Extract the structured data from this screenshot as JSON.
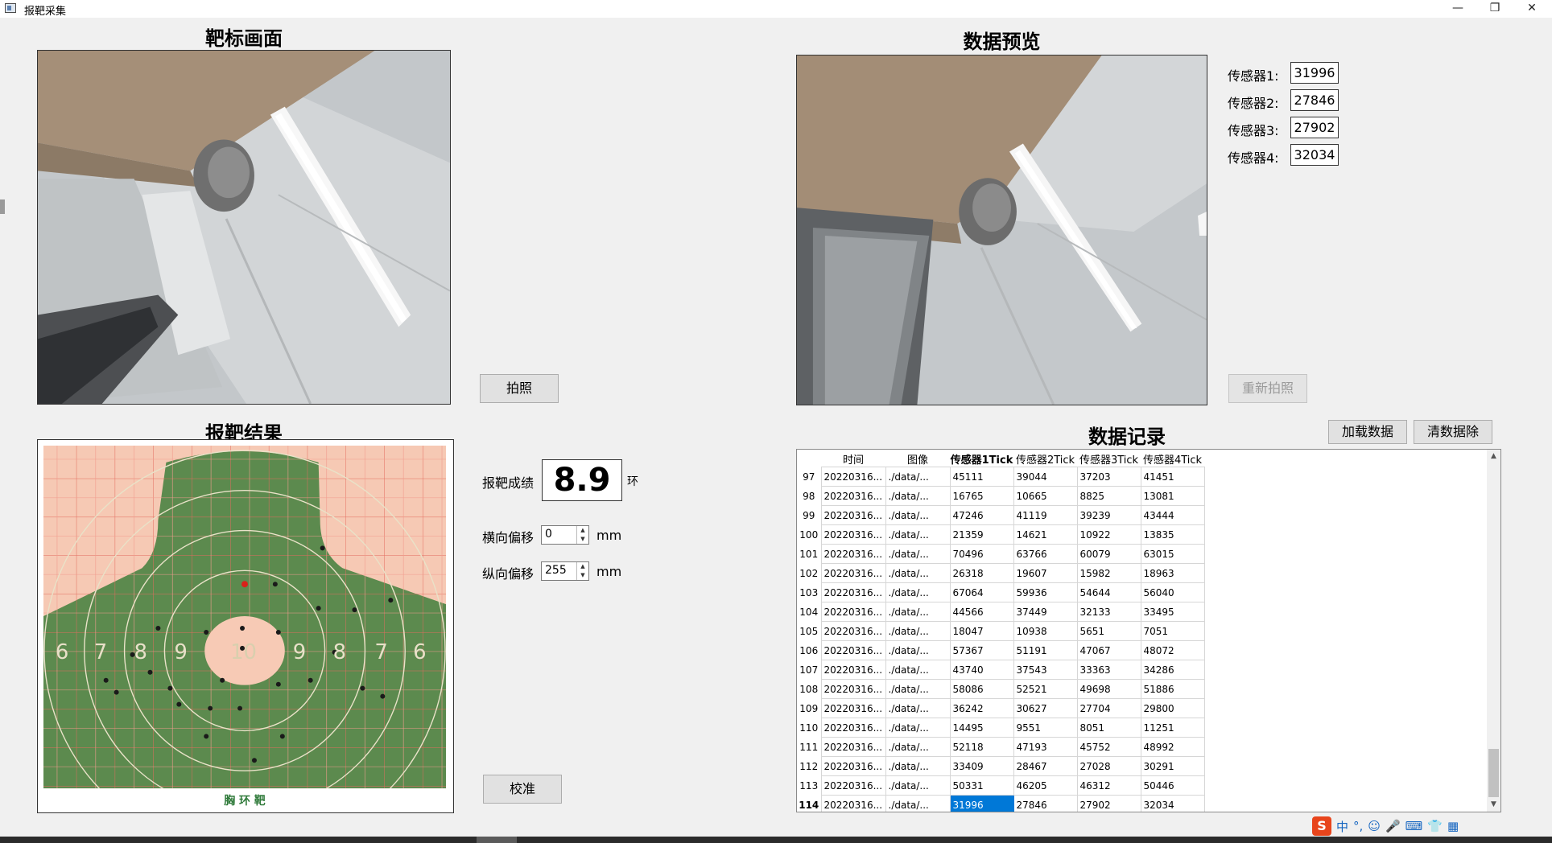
{
  "window": {
    "title": "报靶采集",
    "minimize": "—",
    "restore": "❐",
    "close": "✕"
  },
  "left": {
    "camera_heading": "靶标画面",
    "capture_button": "拍照",
    "result_heading": "报靶结果",
    "target_caption": "胸    环    靶",
    "ring_labels_left": [
      "6",
      "7",
      "8",
      "9",
      "10"
    ],
    "ring_labels_right": [
      "9",
      "8",
      "7",
      "6"
    ],
    "score_label": "报靶成绩",
    "score_value": "8.9",
    "score_unit": "环",
    "h_offset_label": "横向偏移",
    "h_offset_value": "0",
    "v_offset_label": "纵向偏移",
    "v_offset_value": "255",
    "offset_unit": "mm",
    "calibrate_button": "校准"
  },
  "right": {
    "preview_heading": "数据预览",
    "retake_button": "重新拍照",
    "sensors": [
      {
        "label": "传感器1:",
        "value": "31996"
      },
      {
        "label": "传感器2:",
        "value": "27846"
      },
      {
        "label": "传感器3:",
        "value": "27902"
      },
      {
        "label": "传感器4:",
        "value": "32034"
      }
    ],
    "records_heading": "数据记录",
    "load_button": "加载数据",
    "clear_button": "清数据除",
    "table": {
      "headers": [
        "时间",
        "图像",
        "传感器1Tick",
        "传感器2Tick",
        "传感器3Tick",
        "传感器4Tick"
      ],
      "rows": [
        {
          "n": "97",
          "time": "20220316...",
          "img": "./data/...",
          "s1": "45111",
          "s2": "39044",
          "s3": "37203",
          "s4": "41451"
        },
        {
          "n": "98",
          "time": "20220316...",
          "img": "./data/...",
          "s1": "16765",
          "s2": "10665",
          "s3": "8825",
          "s4": "13081"
        },
        {
          "n": "99",
          "time": "20220316...",
          "img": "./data/...",
          "s1": "47246",
          "s2": "41119",
          "s3": "39239",
          "s4": "43444"
        },
        {
          "n": "100",
          "time": "20220316...",
          "img": "./data/...",
          "s1": "21359",
          "s2": "14621",
          "s3": "10922",
          "s4": "13835"
        },
        {
          "n": "101",
          "time": "20220316...",
          "img": "./data/...",
          "s1": "70496",
          "s2": "63766",
          "s3": "60079",
          "s4": "63015"
        },
        {
          "n": "102",
          "time": "20220316...",
          "img": "./data/...",
          "s1": "26318",
          "s2": "19607",
          "s3": "15982",
          "s4": "18963"
        },
        {
          "n": "103",
          "time": "20220316...",
          "img": "./data/...",
          "s1": "67064",
          "s2": "59936",
          "s3": "54644",
          "s4": "56040"
        },
        {
          "n": "104",
          "time": "20220316...",
          "img": "./data/...",
          "s1": "44566",
          "s2": "37449",
          "s3": "32133",
          "s4": "33495"
        },
        {
          "n": "105",
          "time": "20220316...",
          "img": "./data/...",
          "s1": "18047",
          "s2": "10938",
          "s3": "5651",
          "s4": "7051"
        },
        {
          "n": "106",
          "time": "20220316...",
          "img": "./data/...",
          "s1": "57367",
          "s2": "51191",
          "s3": "47067",
          "s4": "48072"
        },
        {
          "n": "107",
          "time": "20220316...",
          "img": "./data/...",
          "s1": "43740",
          "s2": "37543",
          "s3": "33363",
          "s4": "34286"
        },
        {
          "n": "108",
          "time": "20220316...",
          "img": "./data/...",
          "s1": "58086",
          "s2": "52521",
          "s3": "49698",
          "s4": "51886"
        },
        {
          "n": "109",
          "time": "20220316...",
          "img": "./data/...",
          "s1": "36242",
          "s2": "30627",
          "s3": "27704",
          "s4": "29800"
        },
        {
          "n": "110",
          "time": "20220316...",
          "img": "./data/...",
          "s1": "14495",
          "s2": "9551",
          "s3": "8051",
          "s4": "11251"
        },
        {
          "n": "111",
          "time": "20220316...",
          "img": "./data/...",
          "s1": "52118",
          "s2": "47193",
          "s3": "45752",
          "s4": "48992"
        },
        {
          "n": "112",
          "time": "20220316...",
          "img": "./data/...",
          "s1": "33409",
          "s2": "28467",
          "s3": "27028",
          "s4": "30291"
        },
        {
          "n": "113",
          "time": "20220316...",
          "img": "./data/...",
          "s1": "50331",
          "s2": "46205",
          "s3": "46312",
          "s4": "50446"
        },
        {
          "n": "114",
          "time": "20220316...",
          "img": "./data/...",
          "s1": "31996",
          "s2": "27846",
          "s3": "27902",
          "s4": "32034"
        }
      ],
      "selected_row": "114"
    }
  },
  "tray": {
    "ime_logo": "S",
    "ime_mode": "中"
  },
  "colors": {
    "target_green": "#5c8a4e",
    "target_bg": "#f6c9b4",
    "selection": "#0078d7"
  }
}
